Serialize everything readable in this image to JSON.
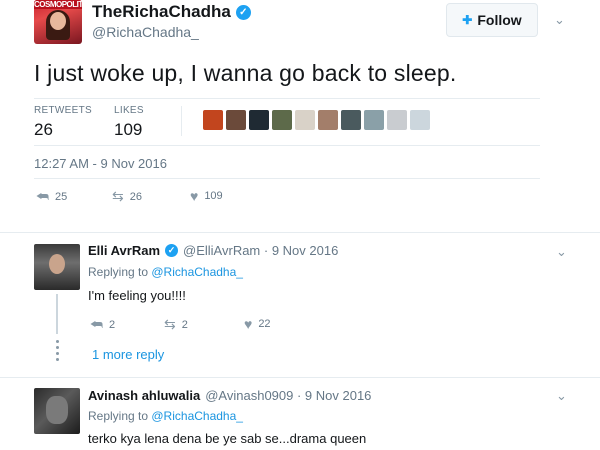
{
  "tweet": {
    "avatar_text": "COSMOPOLITAN",
    "display_name": "TheRichaChadha",
    "handle": "@RichaChadha_",
    "follow_label": "Follow",
    "text": "I just woke up, I wanna go back to sleep.",
    "stats": {
      "retweets_label": "RETWEETS",
      "retweets": "26",
      "likes_label": "LIKES",
      "likes": "109"
    },
    "timestamp": "12:27 AM - 9 Nov 2016",
    "actions": {
      "reply": "25",
      "retweet": "26",
      "like": "109"
    },
    "liker_colors": [
      "#c2451e",
      "#6b4a3a",
      "#1f2a33",
      "#5d6a4a",
      "#d9d2c8",
      "#a37e6a",
      "#4a5a5e",
      "#8aa0a8",
      "#c9ccd0",
      "#ccd6dd"
    ]
  },
  "replies": [
    {
      "name": "Elli AvrRam",
      "verified": true,
      "handle_date": "@ElliAvrRam · 9 Nov 2016",
      "replying_prefix": "Replying to ",
      "replying_to": "@RichaChadha_",
      "text": "I'm feeling you!!!!",
      "actions": {
        "reply": "2",
        "retweet": "2",
        "like": "22"
      },
      "more_reply": "1 more reply"
    },
    {
      "name": "Avinash ahluwalia",
      "verified": false,
      "handle_date": "@Avinash0909 · 9 Nov 2016",
      "replying_prefix": "Replying to ",
      "replying_to": "@RichaChadha_",
      "text": "terko kya lena dena be ye sab se...drama queen"
    }
  ],
  "icons": {
    "reply": "reply-icon",
    "retweet": "retweet-icon",
    "like": "heart-icon",
    "caret": "chevron-down-icon",
    "verified": "verified-badge-icon"
  },
  "colors": {
    "accent": "#1da1f2",
    "link": "#1b95e0",
    "muted": "#657786",
    "divider": "#e6ecf0"
  }
}
